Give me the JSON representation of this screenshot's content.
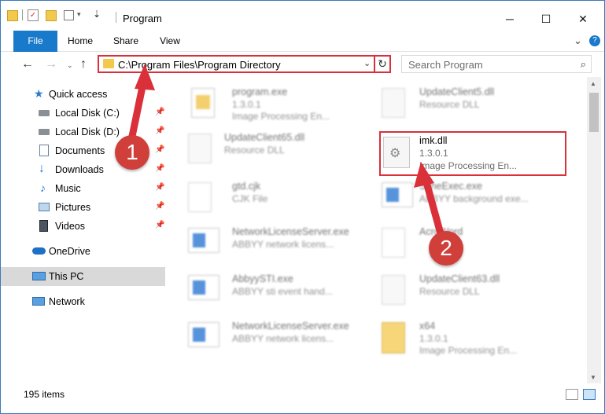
{
  "window": {
    "title": "Program"
  },
  "ribbon": {
    "tabs": [
      "File",
      "Home",
      "Share",
      "View"
    ]
  },
  "address": {
    "path": "C:\\Program Files\\Program Directory"
  },
  "search": {
    "placeholder": "Search Program"
  },
  "sidebar": {
    "items": [
      {
        "label": "Quick access",
        "icon": "star-icon",
        "pinned": false
      },
      {
        "label": "Local Disk (C:)",
        "icon": "drive-icon",
        "pinned": true
      },
      {
        "label": "Local Disk (D:)",
        "icon": "drive-icon",
        "pinned": true
      },
      {
        "label": "Documents",
        "icon": "documents-icon",
        "pinned": true
      },
      {
        "label": "Downloads",
        "icon": "download-arrow-icon",
        "pinned": true
      },
      {
        "label": "Music",
        "icon": "music-note-icon",
        "pinned": true
      },
      {
        "label": "Pictures",
        "icon": "pictures-icon",
        "pinned": true
      },
      {
        "label": "Videos",
        "icon": "film-icon",
        "pinned": true
      },
      {
        "label": "OneDrive",
        "icon": "cloud-icon",
        "pinned": false
      },
      {
        "label": "This PC",
        "icon": "computer-icon",
        "pinned": false,
        "selected": true
      },
      {
        "label": "Network",
        "icon": "network-icon",
        "pinned": false
      }
    ]
  },
  "files": {
    "left": [
      {
        "name": "program.exe",
        "line2": "1.3.0.1",
        "line3": "Image Processing En..."
      },
      {
        "name": "UpdateClient65.dll",
        "line2": "Resource DLL",
        "line3": ""
      },
      {
        "name": "gtd.cjk",
        "line2": "CJK File",
        "line3": ""
      },
      {
        "name": "NetworkLicenseServer.exe",
        "line2": "ABBYY network licens...",
        "line3": ""
      },
      {
        "name": "AbbyySTI.exe",
        "line2": "ABBYY sti event hand...",
        "line3": ""
      },
      {
        "name": "NetworkLicenseServer.exe",
        "line2": "ABBYY network licens...",
        "line3": ""
      }
    ],
    "right": [
      {
        "name": "UpdateClient5.dll",
        "line2": "Resource DLL",
        "line3": ""
      },
      {
        "name": "imk.dll",
        "line2": "1.3.0.1",
        "line3": "Image Processing En..."
      },
      {
        "name": "ScheExec.exe",
        "line2": "ABBYY background exe...",
        "line3": ""
      },
      {
        "name": "AcroWord",
        "line2": "",
        "line3": ""
      },
      {
        "name": "UpdateClient63.dll",
        "line2": "Resource DLL",
        "line3": ""
      },
      {
        "name": "x64",
        "line2": "1.3.0.1",
        "line3": "Image Processing En..."
      }
    ]
  },
  "status": {
    "items_count": "195 items"
  },
  "annotations": {
    "step1": "1",
    "step2": "2"
  },
  "colors": {
    "accent": "#1979ca",
    "highlight": "#d9303a"
  }
}
